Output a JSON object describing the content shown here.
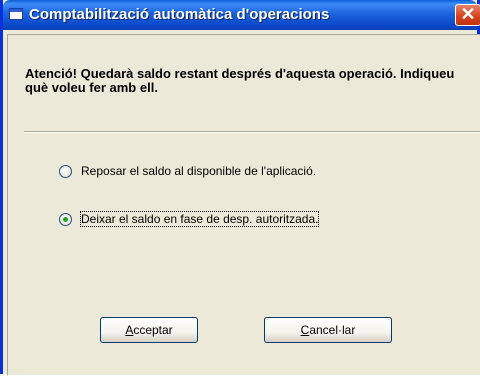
{
  "window": {
    "title": "Comptabilització automàtica d'operacions",
    "close_glyph": "✕",
    "icon": "app-window-icon"
  },
  "message": "Atenció! Quedarà saldo restant després d'aquesta operació. Indiqueu què voleu fer amb ell.",
  "options": [
    {
      "label": "Reposar el saldo al  disponible de l'aplicació.",
      "selected": false
    },
    {
      "label": "Deixar el saldo en fase de desp. autoritzada.",
      "selected": true
    }
  ],
  "buttons": {
    "accept": {
      "mnemonic": "A",
      "rest": "cceptar"
    },
    "cancel": {
      "mnemonic": "C",
      "rest": "ancel·lar"
    }
  },
  "colors": {
    "titlebar": "#0a48c8",
    "dialog_background": "#ece9d8",
    "close_button": "#d6451f",
    "radio_dot": "#21a121"
  }
}
